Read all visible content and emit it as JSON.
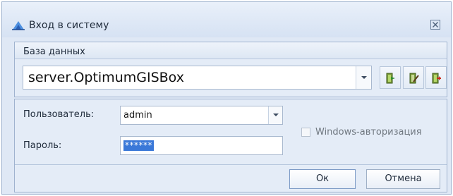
{
  "window": {
    "title": "Вход в систему",
    "close_icon": "close-icon"
  },
  "database": {
    "label": "База данных",
    "value": "server.OptimumGISBox",
    "tools": [
      {
        "name": "connect-db-icon"
      },
      {
        "name": "edit-db-icon"
      },
      {
        "name": "remove-db-icon"
      }
    ]
  },
  "user": {
    "label": "Пользователь:",
    "value": "admin"
  },
  "password": {
    "label": "Пароль:",
    "value": "******"
  },
  "windows_auth": {
    "label": "Windows-авторизация",
    "checked": false
  },
  "buttons": {
    "ok": "Ок",
    "cancel": "Отмена"
  },
  "colors": {
    "accent": "#3a78d8",
    "panel": "#e4ecf7"
  }
}
